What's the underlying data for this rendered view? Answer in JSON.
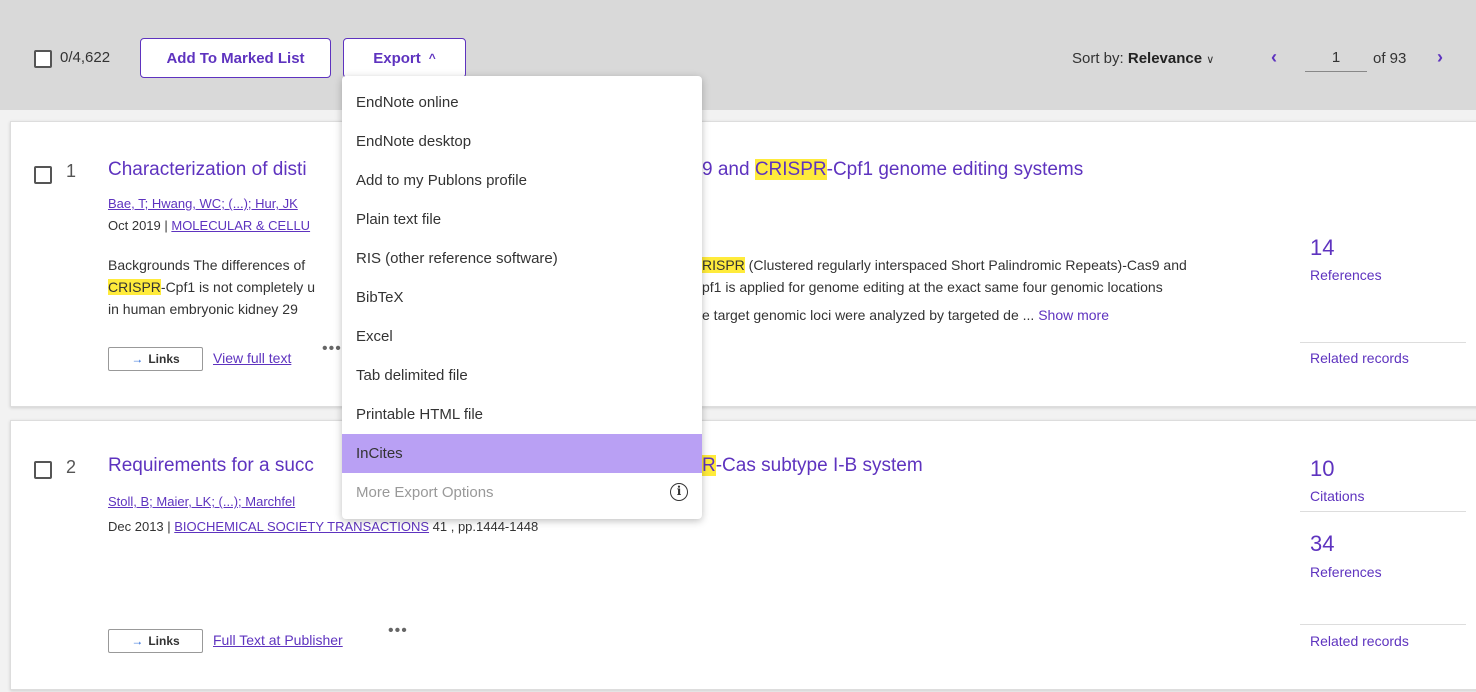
{
  "toolbar": {
    "select_count": "0/4,622",
    "add_marked_label": "Add To Marked List",
    "export_label": "Export",
    "sort_prefix": "Sort by:",
    "sort_value": "Relevance",
    "current_page": "1",
    "of_pages": "of 93"
  },
  "export_menu": {
    "items": [
      "EndNote online",
      "EndNote desktop",
      "Add to my Publons profile",
      "Plain text file",
      "RIS (other reference software)",
      "BibTeX",
      "Excel",
      "Tab delimited file",
      "Printable HTML file",
      "InCites",
      "More Export Options"
    ],
    "active_item": "InCites"
  },
  "records": [
    {
      "number": "1",
      "title_pre": "Characterization of disti",
      "title_hl": "CRISPR",
      "title_mid": "9 and ",
      "title_post": "-Cpf1 genome editing systems",
      "authors": "Bae, T; Hwang, WC; (...); Hur, JK",
      "date": "Oct 2019 | ",
      "journal": "MOLECULAR & CELLU",
      "abstract_line1_pre": "Backgrounds The differences of",
      "abstract_line1_hl": "RISPR",
      "abstract_line1_post": " (Clustered regularly interspaced Short Palindromic Repeats)-Cas9 and",
      "abstract_line2_hl": "CRISPR",
      "abstract_line2_pre": "-Cpf1 is not completely u",
      "abstract_line2_post": "pf1 is applied for genome editing at the exact same four genomic locations",
      "abstract_line3_pre": "in human embryonic kidney 29",
      "abstract_line3_post": "e target genomic loci were analyzed by targeted de ... ",
      "show_more": "Show more",
      "links_label": "Links",
      "full_text_link": "View full text",
      "references_count": "14",
      "references_label": "References",
      "related_label": "Related records"
    },
    {
      "number": "2",
      "title_pre": "Requirements for a succ",
      "title_hl": "R",
      "title_post": "-Cas subtype I-B system",
      "authors": "Stoll, B; Maier, LK; (...); Marchfel",
      "date": "Dec 2013 | ",
      "journal": "BIOCHEMICAL SOCIETY TRANSACTIONS",
      "volume_pages": " 41 , pp.1444-1448",
      "links_label": "Links",
      "full_text_link": "Full Text at Publisher",
      "citations_count": "10",
      "citations_label": "Citations",
      "references_count": "34",
      "references_label": "References",
      "related_label": "Related records"
    }
  ]
}
